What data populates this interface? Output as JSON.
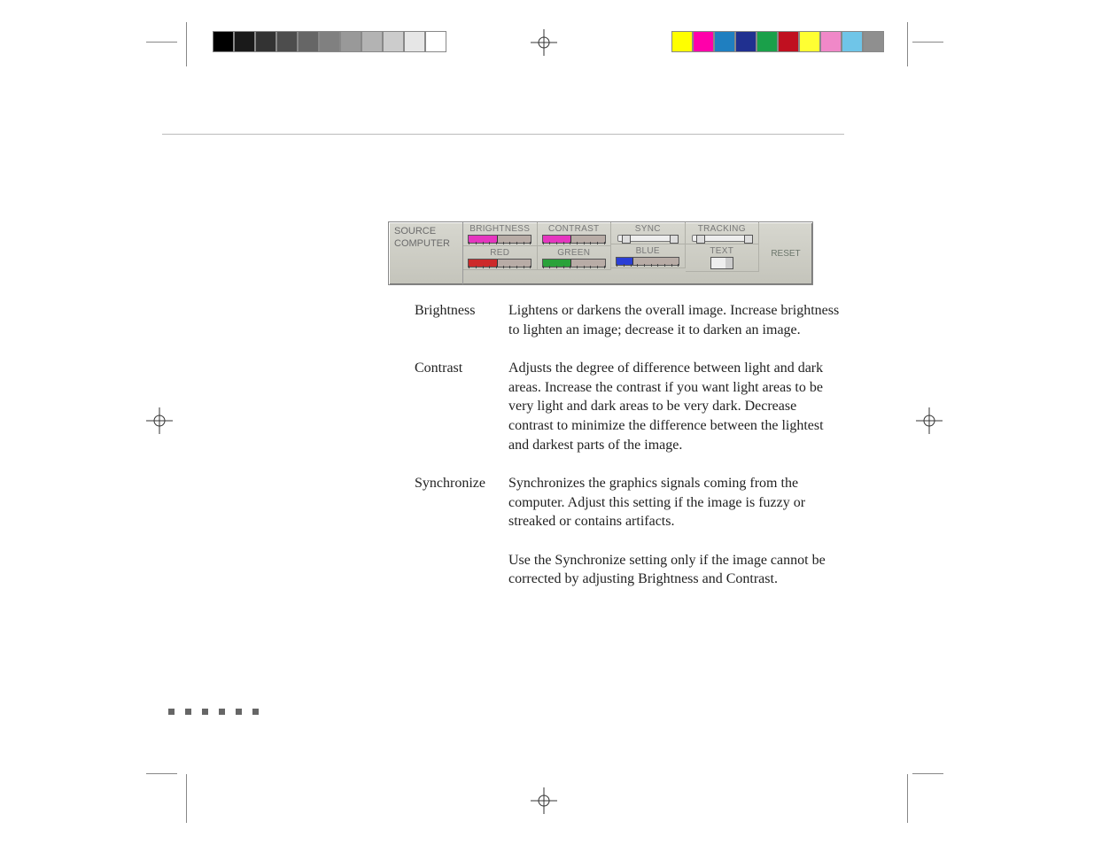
{
  "panel": {
    "source_label": "SOURCE",
    "source_value": "COMPUTER",
    "top": {
      "brightness_label": "BRIGHTNESS",
      "contrast_label": "CONTRAST",
      "sync_label": "SYNC",
      "tracking_label": "TRACKING",
      "reset_label": "RESET"
    },
    "bottom": {
      "red_label": "RED",
      "green_label": "GREEN",
      "blue_label": "BLUE",
      "text_label": "TEXT"
    }
  },
  "definitions": {
    "brightness": {
      "term": "Brightness",
      "body": "Lightens or darkens the overall image. Increase brightness to lighten an image; decrease it to darken an image."
    },
    "contrast": {
      "term": "Contrast",
      "body": "Adjusts the degree of difference between light and dark areas. Increase the contrast if you want light areas to be very light and dark areas to be very dark. Decrease contrast to minimize the difference between the lightest and darkest parts of the image."
    },
    "synchronize": {
      "term": "Synchronize",
      "body1": "Synchronizes the graphics signals coming from the computer. Adjust this setting if the image is fuzzy or streaked or contains artifacts.",
      "body2": "Use the Synchronize setting only if the image cannot be corrected by adjusting Brightness and Contrast."
    }
  },
  "colorbars": {
    "gray": [
      "#000000",
      "#1a1a1a",
      "#333333",
      "#4d4d4d",
      "#666666",
      "#808080",
      "#999999",
      "#b3b3b3",
      "#cccccc",
      "#e6e6e6",
      "#ffffff"
    ],
    "color": [
      "#ffff00",
      "#ff00aa",
      "#1f7fc0",
      "#203090",
      "#1aa04a",
      "#c01020",
      "#ffff33",
      "#f088c8",
      "#6fc5e8",
      "#8f8f8f"
    ]
  }
}
